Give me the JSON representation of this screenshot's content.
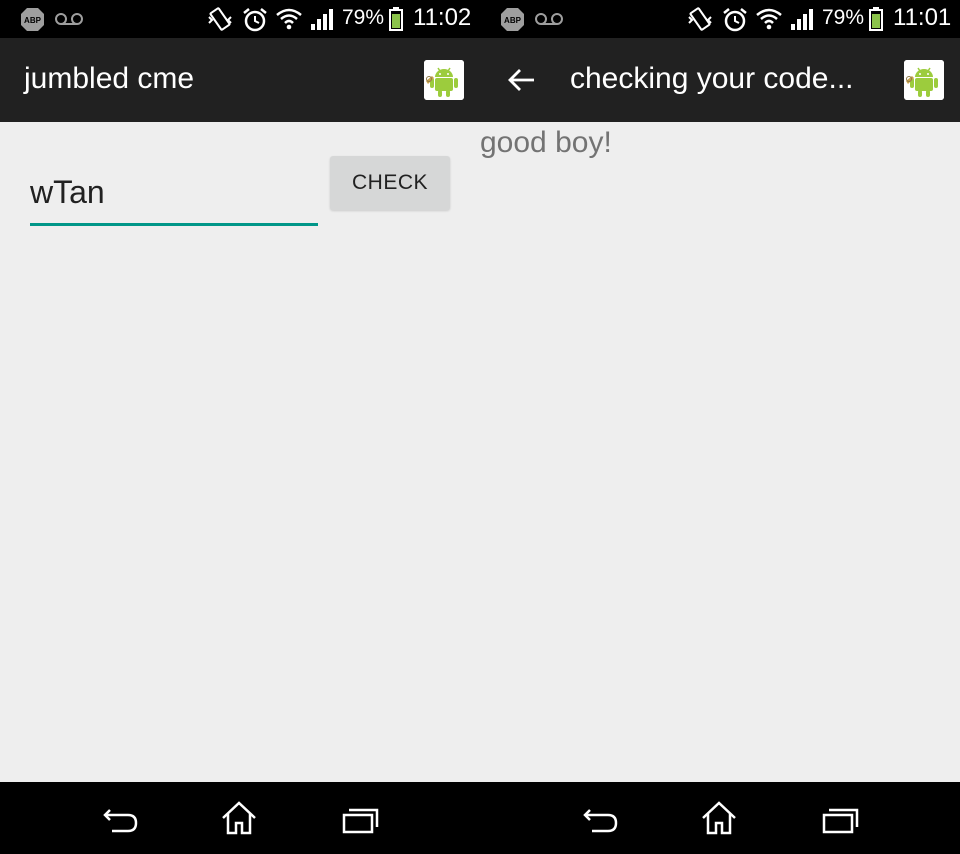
{
  "status_bar_left": {
    "battery_percent": "79%",
    "time": "11:02"
  },
  "status_bar_right": {
    "battery_percent": "79%",
    "time": "11:01"
  },
  "screen_main": {
    "title": "jumbled cme",
    "input_value": "wTan",
    "check_button_label": "CHECK"
  },
  "screen_result": {
    "title": "checking your code...",
    "result_text": "good boy!"
  },
  "icons": {
    "status": [
      "adblock-icon",
      "voicemail-icon",
      "vibrate-icon",
      "alarm-icon",
      "wifi-icon",
      "signal-icon",
      "battery-icon"
    ],
    "app": "android-app-icon",
    "nav": [
      "back-icon",
      "home-icon",
      "recent-apps-icon"
    ]
  },
  "colors": {
    "action_bar": "#212121",
    "accent": "#009688",
    "background": "#eeeeee",
    "button": "#d6d7d7",
    "result_text": "#737373",
    "battery": "#8bc34a"
  }
}
